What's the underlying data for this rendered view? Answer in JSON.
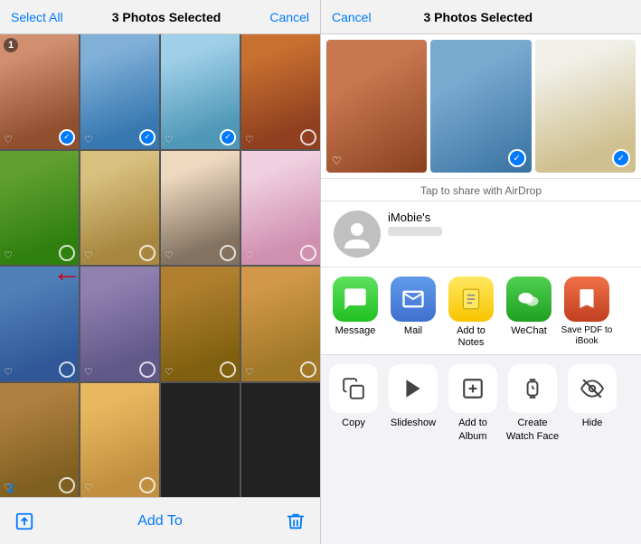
{
  "left": {
    "select_all": "Select All",
    "title": "3 Photos Selected",
    "cancel": "Cancel",
    "add_to": "Add To",
    "badge_num": "1",
    "badge_num2": "2",
    "photos": [
      {
        "id": 1,
        "selected": true,
        "num": "1",
        "classes": "pg1"
      },
      {
        "id": 2,
        "selected": true,
        "classes": "pg2"
      },
      {
        "id": 3,
        "selected": true,
        "classes": "pg3"
      },
      {
        "id": 4,
        "selected": false,
        "classes": "pg4"
      },
      {
        "id": 5,
        "selected": false,
        "classes": "pg5"
      },
      {
        "id": 6,
        "selected": false,
        "classes": "pg6"
      },
      {
        "id": 7,
        "selected": false,
        "classes": "pg7"
      },
      {
        "id": 8,
        "selected": false,
        "classes": "pg8"
      },
      {
        "id": 9,
        "selected": false,
        "classes": "pg9"
      },
      {
        "id": 10,
        "selected": false,
        "classes": "pg10"
      },
      {
        "id": 11,
        "selected": false,
        "classes": "pg11"
      },
      {
        "id": 12,
        "selected": false,
        "classes": "pg12"
      },
      {
        "id": 13,
        "selected": false,
        "classes": "pg13"
      },
      {
        "id": 14,
        "selected": false,
        "classes": "pg14"
      }
    ]
  },
  "right": {
    "cancel": "Cancel",
    "title": "3 Photos Selected",
    "airdrop_hint": "Tap to share with AirDrop",
    "contact_name": "iMobie's",
    "strip": [
      {
        "classes": "p1",
        "selected": false
      },
      {
        "classes": "p2",
        "selected": true
      },
      {
        "classes": "p3",
        "selected": true
      }
    ],
    "apps": [
      {
        "id": "message",
        "label": "Message",
        "icon": "💬",
        "icon_class": "icon-message"
      },
      {
        "id": "mail",
        "label": "Mail",
        "icon": "✉️",
        "icon_class": "icon-mail"
      },
      {
        "id": "notes",
        "label": "Add to Notes",
        "icon": "📝",
        "icon_class": "icon-notes"
      },
      {
        "id": "wechat",
        "label": "WeChat",
        "icon": "💬",
        "icon_class": "icon-wechat"
      },
      {
        "id": "books",
        "label": "Save PDF\nto iBook",
        "icon": "📖",
        "icon_class": "icon-books"
      }
    ],
    "actions": [
      {
        "id": "copy",
        "label": "Copy",
        "icon": "⧉"
      },
      {
        "id": "slideshow",
        "label": "Slideshow",
        "icon": "▶"
      },
      {
        "id": "add-album",
        "label": "Add to Album",
        "icon": "➕"
      },
      {
        "id": "watchface",
        "label": "Create\nWatch Face",
        "icon": "⌚"
      },
      {
        "id": "hide",
        "label": "Hide",
        "icon": "⊘"
      }
    ]
  }
}
